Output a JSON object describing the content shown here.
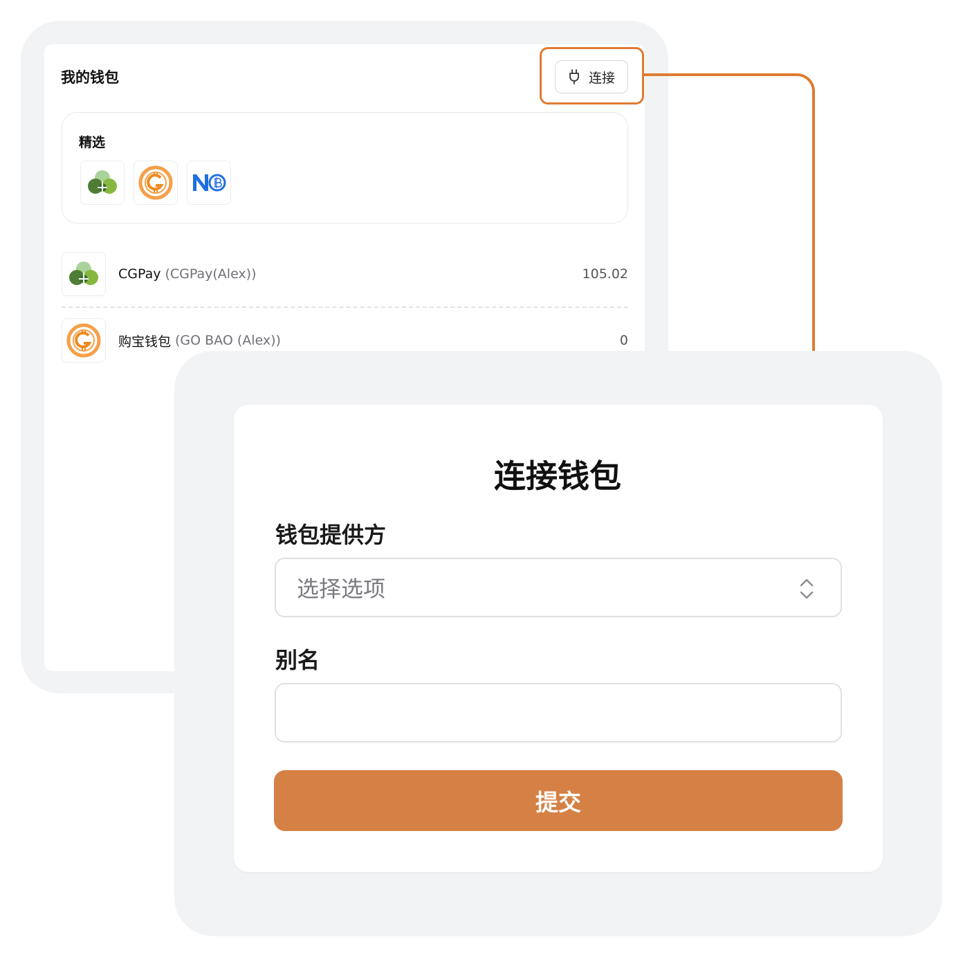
{
  "wallet_panel": {
    "title": "我的钱包",
    "connect_button": {
      "label": "连接",
      "icon": "plug-icon"
    },
    "featured": {
      "title": "精选",
      "logos": [
        {
          "name": "CGPay",
          "icon": "cgpay-logo-icon"
        },
        {
          "name": "购宝钱包",
          "icon": "gobao-logo-icon"
        },
        {
          "name": "NO",
          "icon": "nob-logo-icon"
        }
      ]
    },
    "wallets": [
      {
        "name": "CGPay",
        "account": "(CGPay(Alex))",
        "balance": "105.02"
      },
      {
        "name": "购宝钱包",
        "account": "(GO BAO (Alex))",
        "balance": "0"
      }
    ]
  },
  "connect_form": {
    "title": "连接钱包",
    "provider_label": "钱包提供方",
    "provider_placeholder": "选择选项",
    "alias_label": "别名",
    "alias_value": "",
    "submit_label": "提交"
  },
  "colors": {
    "accent": "#df7b32",
    "submit": "#d58045",
    "frame_bg": "#f2f3f5"
  }
}
